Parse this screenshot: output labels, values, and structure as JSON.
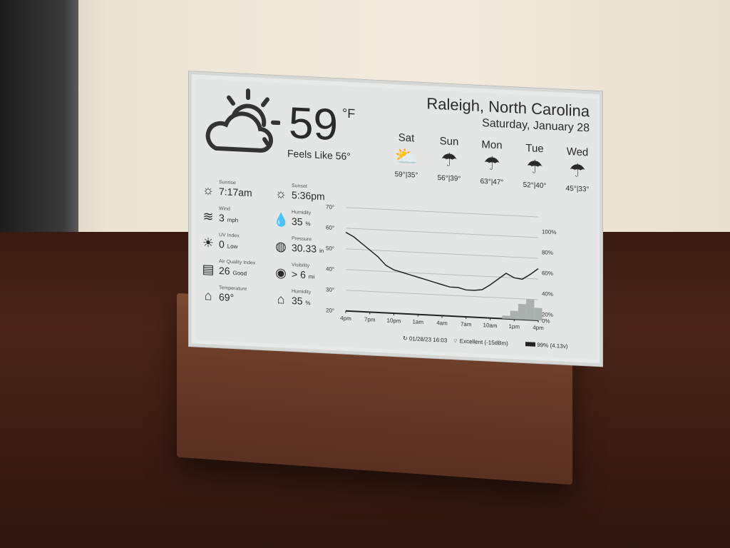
{
  "location": "Raleigh, North Carolina",
  "date": "Saturday, January 28",
  "current": {
    "temp": "59",
    "unit": "°F",
    "feels_like": "Feels Like 56°",
    "icon": "partly-cloudy-icon"
  },
  "forecast": [
    {
      "day": "Sat",
      "icon": "partly-sunny-icon",
      "temps": "59°|35°"
    },
    {
      "day": "Sun",
      "icon": "rain-icon",
      "temps": "56°|39°"
    },
    {
      "day": "Mon",
      "icon": "rain-icon",
      "temps": "63°|47°"
    },
    {
      "day": "Tue",
      "icon": "rain-icon",
      "temps": "52°|40°"
    },
    {
      "day": "Wed",
      "icon": "rain-icon",
      "temps": "45°|33°"
    }
  ],
  "details": [
    {
      "label": "Sunrise",
      "value": "7:17am",
      "unit": "",
      "icon": "sunrise-icon"
    },
    {
      "label": "Sunset",
      "value": "5:36pm",
      "unit": "",
      "icon": "sunset-icon"
    },
    {
      "label": "Wind",
      "value": "3",
      "unit": "mph",
      "icon": "wind-icon"
    },
    {
      "label": "Humidity",
      "value": "35",
      "unit": "%",
      "icon": "humidity-icon"
    },
    {
      "label": "UV Index",
      "value": "0",
      "unit": "Low",
      "icon": "uv-icon"
    },
    {
      "label": "Pressure",
      "value": "30.33",
      "unit": "in",
      "icon": "pressure-icon"
    },
    {
      "label": "Air Quality Index",
      "value": "26",
      "unit": "Good",
      "icon": "air-quality-icon"
    },
    {
      "label": "Visibility",
      "value": "> 6",
      "unit": "mi",
      "icon": "visibility-icon"
    },
    {
      "label": "Temperature",
      "value": "69°",
      "unit": "",
      "icon": "indoor-temp-icon"
    },
    {
      "label": "Humidity",
      "value": "35",
      "unit": "%",
      "icon": "indoor-humidity-icon"
    }
  ],
  "chart_data": {
    "type": "line",
    "x_ticks": [
      "4pm",
      "7pm",
      "10pm",
      "1am",
      "4am",
      "7am",
      "10am",
      "1pm",
      "4pm"
    ],
    "y_ticks_left": [
      "20°",
      "30°",
      "40°",
      "50°",
      "60°",
      "70°"
    ],
    "y_ticks_right": [
      "0%",
      "20%",
      "40%",
      "60%",
      "80%",
      "100%"
    ],
    "ylim_left": [
      20,
      70
    ],
    "ylim_right": [
      0,
      100
    ],
    "grid": true,
    "series": [
      {
        "type": "line",
        "values": [
          58,
          56,
          53,
          50,
          47,
          43,
          41,
          40,
          39,
          38,
          37,
          36,
          35,
          34,
          34,
          33,
          33,
          33.5,
          36,
          39,
          42,
          40,
          39.5,
          42,
          45
        ]
      },
      {
        "type": "bar",
        "values": [
          0,
          0,
          0,
          0,
          0,
          0,
          0,
          0,
          0,
          0,
          0,
          0,
          0,
          0,
          0,
          0,
          0,
          0,
          0,
          0,
          3,
          8,
          15,
          20,
          12
        ]
      }
    ]
  },
  "footer": {
    "updated": "01/28/23 16:03",
    "wifi": "Excellent (-15dBm)",
    "battery": "99% (4.13v)"
  }
}
